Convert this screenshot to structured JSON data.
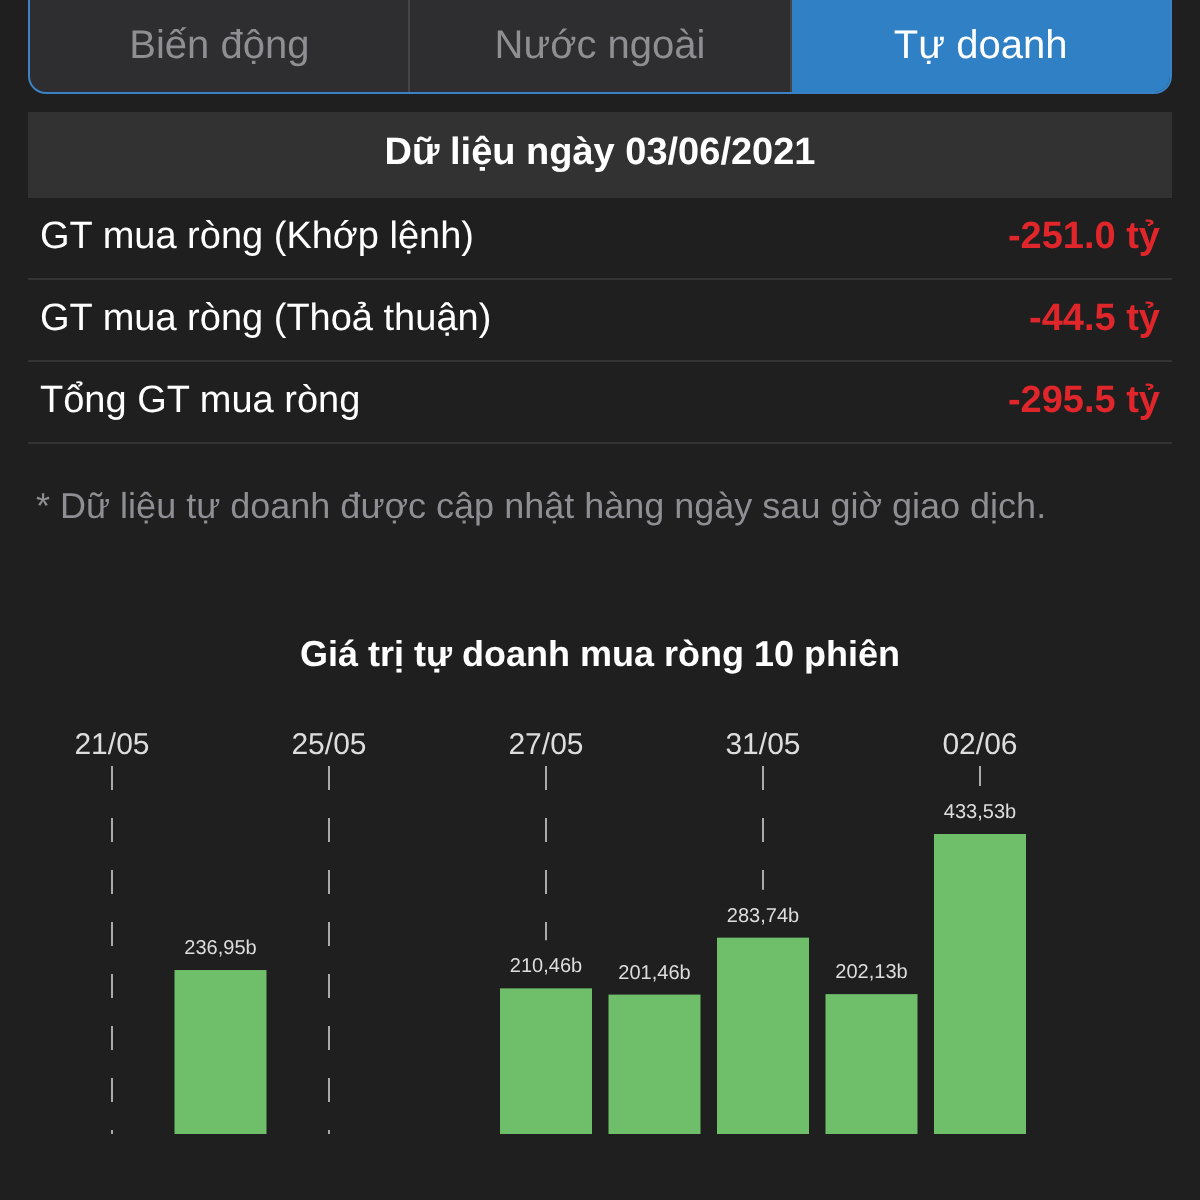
{
  "tabs": [
    {
      "label": "Biến động",
      "selected": false
    },
    {
      "label": "Nước ngoài",
      "selected": false
    },
    {
      "label": "Tự doanh",
      "selected": true
    }
  ],
  "header": "Dữ liệu ngày 03/06/2021",
  "rows": [
    {
      "label": "GT mua ròng (Khớp lệnh)",
      "value": "-251.0 tỷ",
      "negative": true
    },
    {
      "label": "GT mua ròng (Thoả thuận)",
      "value": "-44.5 tỷ",
      "negative": true
    },
    {
      "label": "Tổng GT mua ròng",
      "value": "-295.5 tỷ",
      "negative": true
    }
  ],
  "note": "* Dữ liệu tự doanh được cập nhật hàng ngày sau giờ giao dịch.",
  "chart": {
    "chart_data": {
      "type": "bar",
      "title": "Giá trị tự doanh mua ròng 10 phiên",
      "categories": [
        "21/05",
        null,
        "25/05",
        null,
        "27/05",
        null,
        "31/05",
        null,
        "02/06"
      ],
      "series": [
        {
          "color": "#6fbf6a",
          "values": [
            null,
            236.95,
            null,
            null,
            210.46,
            201.46,
            283.74,
            202.13,
            433.53
          ],
          "value_labels": [
            null,
            "236,95b",
            null,
            null,
            "210,46b",
            "201,46b",
            "283,74b",
            "202,13b",
            "433,53b"
          ]
        }
      ]
    }
  }
}
